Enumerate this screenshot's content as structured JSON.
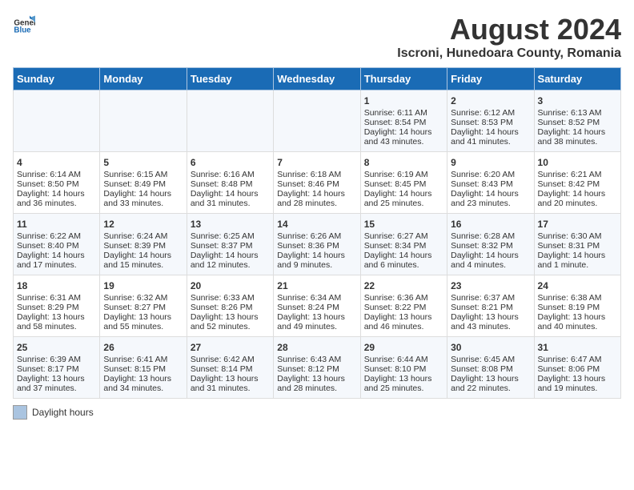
{
  "header": {
    "logo_general": "General",
    "logo_blue": "Blue",
    "month_year": "August 2024",
    "location": "Iscroni, Hunedoara County, Romania"
  },
  "columns": [
    "Sunday",
    "Monday",
    "Tuesday",
    "Wednesday",
    "Thursday",
    "Friday",
    "Saturday"
  ],
  "weeks": [
    [
      {
        "day": "",
        "text": ""
      },
      {
        "day": "",
        "text": ""
      },
      {
        "day": "",
        "text": ""
      },
      {
        "day": "",
        "text": ""
      },
      {
        "day": "1",
        "text": "Sunrise: 6:11 AM\nSunset: 8:54 PM\nDaylight: 14 hours and 43 minutes."
      },
      {
        "day": "2",
        "text": "Sunrise: 6:12 AM\nSunset: 8:53 PM\nDaylight: 14 hours and 41 minutes."
      },
      {
        "day": "3",
        "text": "Sunrise: 6:13 AM\nSunset: 8:52 PM\nDaylight: 14 hours and 38 minutes."
      }
    ],
    [
      {
        "day": "4",
        "text": "Sunrise: 6:14 AM\nSunset: 8:50 PM\nDaylight: 14 hours and 36 minutes."
      },
      {
        "day": "5",
        "text": "Sunrise: 6:15 AM\nSunset: 8:49 PM\nDaylight: 14 hours and 33 minutes."
      },
      {
        "day": "6",
        "text": "Sunrise: 6:16 AM\nSunset: 8:48 PM\nDaylight: 14 hours and 31 minutes."
      },
      {
        "day": "7",
        "text": "Sunrise: 6:18 AM\nSunset: 8:46 PM\nDaylight: 14 hours and 28 minutes."
      },
      {
        "day": "8",
        "text": "Sunrise: 6:19 AM\nSunset: 8:45 PM\nDaylight: 14 hours and 25 minutes."
      },
      {
        "day": "9",
        "text": "Sunrise: 6:20 AM\nSunset: 8:43 PM\nDaylight: 14 hours and 23 minutes."
      },
      {
        "day": "10",
        "text": "Sunrise: 6:21 AM\nSunset: 8:42 PM\nDaylight: 14 hours and 20 minutes."
      }
    ],
    [
      {
        "day": "11",
        "text": "Sunrise: 6:22 AM\nSunset: 8:40 PM\nDaylight: 14 hours and 17 minutes."
      },
      {
        "day": "12",
        "text": "Sunrise: 6:24 AM\nSunset: 8:39 PM\nDaylight: 14 hours and 15 minutes."
      },
      {
        "day": "13",
        "text": "Sunrise: 6:25 AM\nSunset: 8:37 PM\nDaylight: 14 hours and 12 minutes."
      },
      {
        "day": "14",
        "text": "Sunrise: 6:26 AM\nSunset: 8:36 PM\nDaylight: 14 hours and 9 minutes."
      },
      {
        "day": "15",
        "text": "Sunrise: 6:27 AM\nSunset: 8:34 PM\nDaylight: 14 hours and 6 minutes."
      },
      {
        "day": "16",
        "text": "Sunrise: 6:28 AM\nSunset: 8:32 PM\nDaylight: 14 hours and 4 minutes."
      },
      {
        "day": "17",
        "text": "Sunrise: 6:30 AM\nSunset: 8:31 PM\nDaylight: 14 hours and 1 minute."
      }
    ],
    [
      {
        "day": "18",
        "text": "Sunrise: 6:31 AM\nSunset: 8:29 PM\nDaylight: 13 hours and 58 minutes."
      },
      {
        "day": "19",
        "text": "Sunrise: 6:32 AM\nSunset: 8:27 PM\nDaylight: 13 hours and 55 minutes."
      },
      {
        "day": "20",
        "text": "Sunrise: 6:33 AM\nSunset: 8:26 PM\nDaylight: 13 hours and 52 minutes."
      },
      {
        "day": "21",
        "text": "Sunrise: 6:34 AM\nSunset: 8:24 PM\nDaylight: 13 hours and 49 minutes."
      },
      {
        "day": "22",
        "text": "Sunrise: 6:36 AM\nSunset: 8:22 PM\nDaylight: 13 hours and 46 minutes."
      },
      {
        "day": "23",
        "text": "Sunrise: 6:37 AM\nSunset: 8:21 PM\nDaylight: 13 hours and 43 minutes."
      },
      {
        "day": "24",
        "text": "Sunrise: 6:38 AM\nSunset: 8:19 PM\nDaylight: 13 hours and 40 minutes."
      }
    ],
    [
      {
        "day": "25",
        "text": "Sunrise: 6:39 AM\nSunset: 8:17 PM\nDaylight: 13 hours and 37 minutes."
      },
      {
        "day": "26",
        "text": "Sunrise: 6:41 AM\nSunset: 8:15 PM\nDaylight: 13 hours and 34 minutes."
      },
      {
        "day": "27",
        "text": "Sunrise: 6:42 AM\nSunset: 8:14 PM\nDaylight: 13 hours and 31 minutes."
      },
      {
        "day": "28",
        "text": "Sunrise: 6:43 AM\nSunset: 8:12 PM\nDaylight: 13 hours and 28 minutes."
      },
      {
        "day": "29",
        "text": "Sunrise: 6:44 AM\nSunset: 8:10 PM\nDaylight: 13 hours and 25 minutes."
      },
      {
        "day": "30",
        "text": "Sunrise: 6:45 AM\nSunset: 8:08 PM\nDaylight: 13 hours and 22 minutes."
      },
      {
        "day": "31",
        "text": "Sunrise: 6:47 AM\nSunset: 8:06 PM\nDaylight: 13 hours and 19 minutes."
      }
    ]
  ],
  "legend": {
    "daylight_label": "Daylight hours"
  }
}
